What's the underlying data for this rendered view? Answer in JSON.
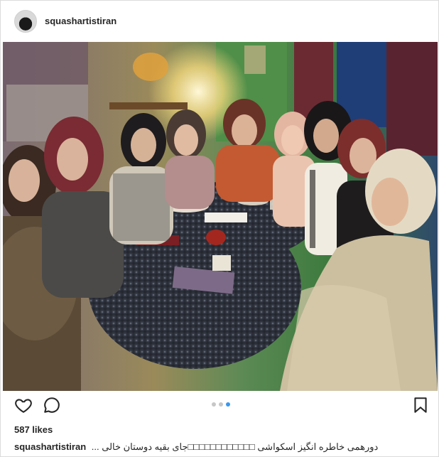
{
  "header": {
    "username": "squashartistiran",
    "avatar_icon": "squash-ball-avatar"
  },
  "photo": {
    "description_alt": "Group of women seated around a cafe table"
  },
  "actions": {
    "like_icon": "heart-outline-icon",
    "comment_icon": "comment-bubble-icon",
    "save_icon": "bookmark-outline-icon",
    "carousel_total": 3,
    "carousel_active": 3
  },
  "likes": {
    "text": "587 likes"
  },
  "caption": {
    "username": "squashartistiran",
    "text": "... دورهمی خاطره انگیز اسکواشی □□□□□□□□□□□□جای بقیه دوستان خالی"
  },
  "colors": {
    "accent": "#3897f0",
    "border": "#dbdbdb",
    "text": "#262626"
  }
}
